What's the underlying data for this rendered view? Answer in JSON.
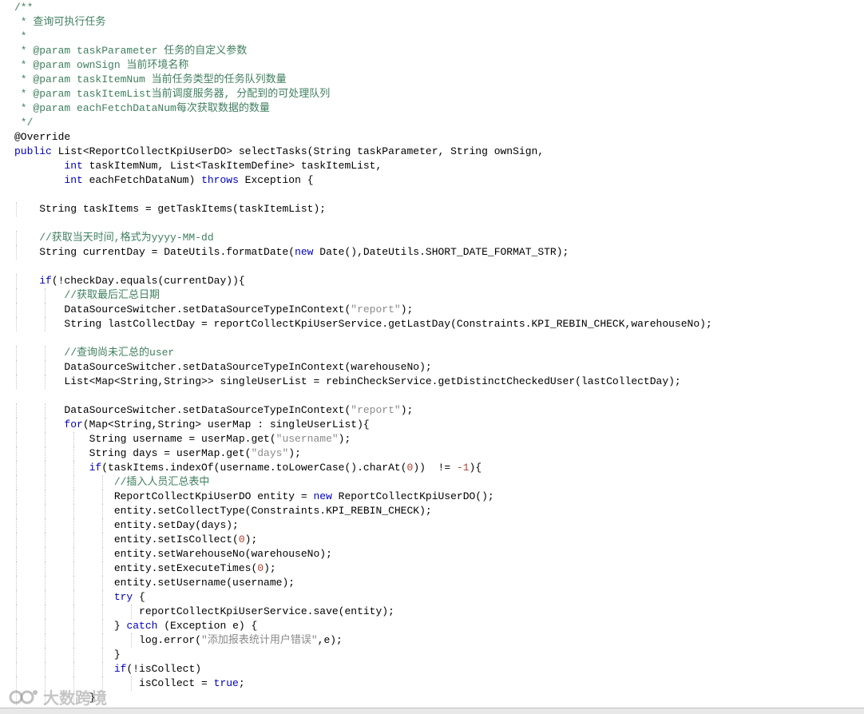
{
  "editor": {
    "lines": [
      [
        {
          "t": "/**",
          "c": "c"
        }
      ],
      [
        {
          "t": " * 查询可执行任务",
          "c": "c"
        }
      ],
      [
        {
          "t": " *",
          "c": "c"
        }
      ],
      [
        {
          "t": " * ",
          "c": "c"
        },
        {
          "t": "@param",
          "c": "c-tag"
        },
        {
          "t": " taskParameter 任务的自定义参数",
          "c": "c"
        }
      ],
      [
        {
          "t": " * ",
          "c": "c"
        },
        {
          "t": "@param",
          "c": "c-tag"
        },
        {
          "t": " ownSign 当前环境名称",
          "c": "c"
        }
      ],
      [
        {
          "t": " * ",
          "c": "c"
        },
        {
          "t": "@param",
          "c": "c-tag"
        },
        {
          "t": " taskItemNum 当前任务类型的任务队列数量",
          "c": "c"
        }
      ],
      [
        {
          "t": " * ",
          "c": "c"
        },
        {
          "t": "@param",
          "c": "c-tag"
        },
        {
          "t": " taskItemList当前调度服务器, 分配到的可处理队列",
          "c": "c"
        }
      ],
      [
        {
          "t": " * ",
          "c": "c"
        },
        {
          "t": "@param",
          "c": "c-tag"
        },
        {
          "t": " eachFetchDataNum每次获取数据的数量",
          "c": "c"
        }
      ],
      [
        {
          "t": " */",
          "c": "c"
        }
      ],
      [
        {
          "t": "@Override",
          "c": ""
        }
      ],
      [
        {
          "t": "public",
          "c": "kw"
        },
        {
          "t": " List<ReportCollectKpiUserDO> selectTasks(String taskParameter, String ownSign,",
          "c": ""
        }
      ],
      [
        {
          "t": "        ",
          "c": ""
        },
        {
          "t": "int",
          "c": "kw"
        },
        {
          "t": " taskItemNum, List<TaskItemDefine> taskItemList,",
          "c": ""
        }
      ],
      [
        {
          "t": "        ",
          "c": ""
        },
        {
          "t": "int",
          "c": "kw"
        },
        {
          "t": " eachFetchDataNum) ",
          "c": ""
        },
        {
          "t": "throws",
          "c": "kw"
        },
        {
          "t": " Exception {",
          "c": ""
        }
      ],
      [],
      [
        {
          "t": "    String taskItems = getTaskItems(taskItemList);",
          "c": ""
        }
      ],
      [],
      [
        {
          "t": "    //获取当天时间,格式为yyyy-MM-dd",
          "c": "c"
        }
      ],
      [
        {
          "t": "    String currentDay = DateUtils.formatDate(",
          "c": ""
        },
        {
          "t": "new",
          "c": "kw"
        },
        {
          "t": " Date(),DateUtils.SHORT_DATE_FORMAT_STR);",
          "c": ""
        }
      ],
      [],
      [
        {
          "t": "    ",
          "c": ""
        },
        {
          "t": "if",
          "c": "kw"
        },
        {
          "t": "(!checkDay.equals(currentDay)){",
          "c": ""
        }
      ],
      [
        {
          "t": "        //获取最后汇总日期",
          "c": "c"
        }
      ],
      [
        {
          "t": "        DataSourceSwitcher.setDataSourceTypeInContext(",
          "c": ""
        },
        {
          "t": "\"report\"",
          "c": "s"
        },
        {
          "t": ");",
          "c": ""
        }
      ],
      [
        {
          "t": "        String lastCollectDay = reportCollectKpiUserService.getLastDay(Constraints.KPI_REBIN_CHECK,warehouseNo);",
          "c": ""
        }
      ],
      [],
      [
        {
          "t": "        //查询尚未汇总的user",
          "c": "c"
        }
      ],
      [
        {
          "t": "        DataSourceSwitcher.setDataSourceTypeInContext(warehouseNo);",
          "c": ""
        }
      ],
      [
        {
          "t": "        List<Map<String,String>> singleUserList = rebinCheckService.getDistinctCheckedUser(lastCollectDay);",
          "c": ""
        }
      ],
      [],
      [
        {
          "t": "        DataSourceSwitcher.setDataSourceTypeInContext(",
          "c": ""
        },
        {
          "t": "\"report\"",
          "c": "s"
        },
        {
          "t": ");",
          "c": ""
        }
      ],
      [
        {
          "t": "        ",
          "c": ""
        },
        {
          "t": "for",
          "c": "kw"
        },
        {
          "t": "(Map<String,String> userMap : singleUserList){",
          "c": ""
        }
      ],
      [
        {
          "t": "            String username = userMap.get(",
          "c": ""
        },
        {
          "t": "\"username\"",
          "c": "s"
        },
        {
          "t": ");",
          "c": ""
        }
      ],
      [
        {
          "t": "            String days = userMap.get(",
          "c": ""
        },
        {
          "t": "\"days\"",
          "c": "s"
        },
        {
          "t": ");",
          "c": ""
        }
      ],
      [
        {
          "t": "            ",
          "c": ""
        },
        {
          "t": "if",
          "c": "kw"
        },
        {
          "t": "(taskItems.indexOf(username.toLowerCase().charAt(",
          "c": ""
        },
        {
          "t": "0",
          "c": "n"
        },
        {
          "t": "))  != ",
          "c": ""
        },
        {
          "t": "-1",
          "c": "n"
        },
        {
          "t": "){",
          "c": ""
        }
      ],
      [
        {
          "t": "                //插入人员汇总表中",
          "c": "c"
        }
      ],
      [
        {
          "t": "                ReportCollectKpiUserDO entity = ",
          "c": ""
        },
        {
          "t": "new",
          "c": "kw"
        },
        {
          "t": " ReportCollectKpiUserDO();",
          "c": ""
        }
      ],
      [
        {
          "t": "                entity.setCollectType(Constraints.KPI_REBIN_CHECK);",
          "c": ""
        }
      ],
      [
        {
          "t": "                entity.setDay(days);",
          "c": ""
        }
      ],
      [
        {
          "t": "                entity.setIsCollect(",
          "c": ""
        },
        {
          "t": "0",
          "c": "n"
        },
        {
          "t": ");",
          "c": ""
        }
      ],
      [
        {
          "t": "                entity.setWarehouseNo(warehouseNo);",
          "c": ""
        }
      ],
      [
        {
          "t": "                entity.setExecuteTimes(",
          "c": ""
        },
        {
          "t": "0",
          "c": "n"
        },
        {
          "t": ");",
          "c": ""
        }
      ],
      [
        {
          "t": "                entity.setUsername(username);",
          "c": ""
        }
      ],
      [
        {
          "t": "                ",
          "c": ""
        },
        {
          "t": "try",
          "c": "kw"
        },
        {
          "t": " {",
          "c": ""
        }
      ],
      [
        {
          "t": "                    reportCollectKpiUserService.save(entity);",
          "c": ""
        }
      ],
      [
        {
          "t": "                } ",
          "c": ""
        },
        {
          "t": "catch",
          "c": "kw"
        },
        {
          "t": " (Exception e) {",
          "c": ""
        }
      ],
      [
        {
          "t": "                    log.error(",
          "c": ""
        },
        {
          "t": "\"添加报表统计用户错误\"",
          "c": "s"
        },
        {
          "t": ",e);",
          "c": ""
        }
      ],
      [
        {
          "t": "                }",
          "c": ""
        }
      ],
      [
        {
          "t": "                ",
          "c": ""
        },
        {
          "t": "if",
          "c": "kw"
        },
        {
          "t": "(!isCollect)",
          "c": ""
        }
      ],
      [
        {
          "t": "                    isCollect = ",
          "c": ""
        },
        {
          "t": "true",
          "c": "kw"
        },
        {
          "t": ";",
          "c": ""
        }
      ],
      [
        {
          "t": "            }",
          "c": ""
        }
      ]
    ]
  },
  "watermark": {
    "text": "大数跨境",
    "icon": "brand-logo-icon"
  },
  "colors": {
    "comment": "#3f7f5f",
    "keyword": "#0000c0",
    "string": "#8a8a8a",
    "number": "#b43c2c",
    "text": "#000000"
  }
}
